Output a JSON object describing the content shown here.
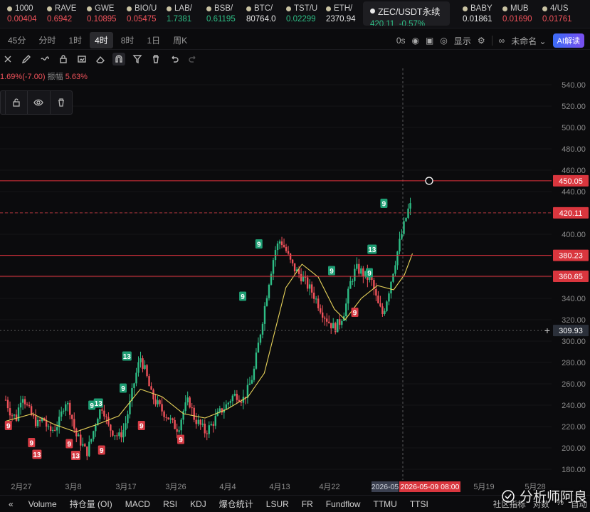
{
  "tickers": [
    {
      "sym": "1000",
      "price": "0.00404",
      "dir": "down"
    },
    {
      "sym": "RAVE",
      "price": "0.6942",
      "dir": "down"
    },
    {
      "sym": "GWE",
      "price": "0.10895",
      "dir": "down"
    },
    {
      "sym": "BIO/U",
      "price": "0.05475",
      "dir": "down"
    },
    {
      "sym": "LAB/",
      "price": "1.7381",
      "dir": "up"
    },
    {
      "sym": "BSB/",
      "price": "0.61195",
      "dir": "up"
    },
    {
      "sym": "BTC/",
      "price": "80764.0",
      "dir": "neu"
    },
    {
      "sym": "TST/U",
      "price": "0.02299",
      "dir": "up"
    },
    {
      "sym": "ETH/",
      "price": "2370.94",
      "dir": "neu"
    }
  ],
  "active_ticker": {
    "sym": "ZEC/USDT永续",
    "price": "420.11",
    "change": "-0.57%"
  },
  "tickers_right": [
    {
      "sym": "BABY",
      "price": "0.01861",
      "dir": "neu"
    },
    {
      "sym": "MUB",
      "price": "0.01690",
      "dir": "down"
    },
    {
      "sym": "4/US",
      "price": "0.01761",
      "dir": "down"
    }
  ],
  "intervals": [
    "45分",
    "分时",
    "1时",
    "4时",
    "8时",
    "1日",
    "周K"
  ],
  "active_interval": "4时",
  "toolbar_right": {
    "countdown": "0s",
    "display": "显示",
    "layout_name": "未命名",
    "ai_label": "AI解读"
  },
  "info": {
    "change": "1.69%(-7.00)",
    "amp_label": "振幅",
    "amp": "5.63%"
  },
  "colors": {
    "up": "#2ebd85",
    "down": "#f0525a",
    "bg": "#0b0b0d",
    "ma": "#e8d35a",
    "hline": "#e0323c",
    "accent_ai": "#5b5cf2"
  },
  "chart_data": {
    "type": "candlestick",
    "symbol": "ZEC/USDT永续",
    "interval": "4时",
    "y_range": [
      170,
      550
    ],
    "y_ticks": [
      180,
      200,
      220,
      240,
      260,
      280,
      300,
      320,
      340,
      360,
      380,
      400,
      420,
      440,
      460,
      480,
      500,
      520,
      540
    ],
    "x_dates": [
      "2月27",
      "3月8",
      "3月17",
      "3月26",
      "4月4",
      "4月13",
      "4月22",
      "2026-05",
      "5月19",
      "5月28"
    ],
    "price_markers": [
      {
        "value": "450.05",
        "style": "solid"
      },
      {
        "value": "420.11",
        "style": "dashed"
      },
      {
        "value": "380.23",
        "style": "solid"
      },
      {
        "value": "360.65",
        "style": "solid"
      },
      {
        "value": "309.93",
        "style": "dotted"
      }
    ],
    "crosshair_date": "2026-05-09 08:00",
    "close_path": [
      [
        0,
        245
      ],
      [
        0.01,
        232
      ],
      [
        0.02,
        228
      ],
      [
        0.03,
        252
      ],
      [
        0.04,
        238
      ],
      [
        0.05,
        228
      ],
      [
        0.06,
        222
      ],
      [
        0.07,
        228
      ],
      [
        0.08,
        215
      ],
      [
        0.09,
        218
      ],
      [
        0.1,
        225
      ],
      [
        0.11,
        245
      ],
      [
        0.12,
        235
      ],
      [
        0.13,
        212
      ],
      [
        0.14,
        205
      ],
      [
        0.15,
        195
      ],
      [
        0.16,
        210
      ],
      [
        0.17,
        230
      ],
      [
        0.18,
        240
      ],
      [
        0.19,
        220
      ],
      [
        0.2,
        215
      ],
      [
        0.21,
        210
      ],
      [
        0.22,
        218
      ],
      [
        0.23,
        240
      ],
      [
        0.24,
        265
      ],
      [
        0.25,
        285
      ],
      [
        0.26,
        270
      ],
      [
        0.27,
        250
      ],
      [
        0.28,
        242
      ],
      [
        0.29,
        235
      ],
      [
        0.3,
        230
      ],
      [
        0.31,
        222
      ],
      [
        0.32,
        218
      ],
      [
        0.33,
        235
      ],
      [
        0.34,
        245
      ],
      [
        0.35,
        228
      ],
      [
        0.36,
        222
      ],
      [
        0.37,
        215
      ],
      [
        0.38,
        220
      ],
      [
        0.39,
        228
      ],
      [
        0.4,
        235
      ],
      [
        0.41,
        240
      ],
      [
        0.42,
        248
      ],
      [
        0.43,
        250
      ],
      [
        0.44,
        245
      ],
      [
        0.45,
        255
      ],
      [
        0.46,
        270
      ],
      [
        0.47,
        300
      ],
      [
        0.48,
        330
      ],
      [
        0.49,
        360
      ],
      [
        0.5,
        385
      ],
      [
        0.51,
        395
      ],
      [
        0.52,
        385
      ],
      [
        0.53,
        372
      ],
      [
        0.54,
        365
      ],
      [
        0.55,
        360
      ],
      [
        0.56,
        352
      ],
      [
        0.57,
        345
      ],
      [
        0.58,
        335
      ],
      [
        0.59,
        325
      ],
      [
        0.6,
        318
      ],
      [
        0.61,
        312
      ],
      [
        0.62,
        318
      ],
      [
        0.63,
        330
      ],
      [
        0.64,
        355
      ],
      [
        0.65,
        368
      ],
      [
        0.66,
        365
      ],
      [
        0.67,
        360
      ],
      [
        0.68,
        355
      ],
      [
        0.69,
        335
      ],
      [
        0.7,
        325
      ],
      [
        0.71,
        345
      ],
      [
        0.72,
        368
      ],
      [
        0.73,
        390
      ],
      [
        0.74,
        410
      ],
      [
        0.75,
        428
      ],
      [
        0.755,
        420
      ]
    ],
    "ma_path": [
      [
        0,
        225
      ],
      [
        0.05,
        232
      ],
      [
        0.09,
        222
      ],
      [
        0.13,
        215
      ],
      [
        0.17,
        222
      ],
      [
        0.21,
        230
      ],
      [
        0.25,
        255
      ],
      [
        0.29,
        248
      ],
      [
        0.33,
        232
      ],
      [
        0.37,
        228
      ],
      [
        0.41,
        236
      ],
      [
        0.45,
        248
      ],
      [
        0.48,
        270
      ],
      [
        0.5,
        310
      ],
      [
        0.52,
        350
      ],
      [
        0.55,
        372
      ],
      [
        0.58,
        360
      ],
      [
        0.61,
        330
      ],
      [
        0.63,
        320
      ],
      [
        0.66,
        340
      ],
      [
        0.69,
        352
      ],
      [
        0.72,
        348
      ],
      [
        0.74,
        362
      ],
      [
        0.755,
        382
      ]
    ],
    "td_labels": [
      {
        "t": "9",
        "x": 0.005,
        "y": 221,
        "c": "down"
      },
      {
        "t": "9",
        "x": 0.048,
        "y": 205,
        "c": "down"
      },
      {
        "t": "13",
        "x": 0.058,
        "y": 194,
        "c": "down"
      },
      {
        "t": "9",
        "x": 0.118,
        "y": 204,
        "c": "down"
      },
      {
        "t": "13",
        "x": 0.13,
        "y": 193,
        "c": "down"
      },
      {
        "t": "9",
        "x": 0.16,
        "y": 240,
        "c": "up"
      },
      {
        "t": "13",
        "x": 0.172,
        "y": 242,
        "c": "up"
      },
      {
        "t": "9",
        "x": 0.178,
        "y": 198,
        "c": "down"
      },
      {
        "t": "9",
        "x": 0.218,
        "y": 256,
        "c": "up"
      },
      {
        "t": "13",
        "x": 0.225,
        "y": 286,
        "c": "up"
      },
      {
        "t": "9",
        "x": 0.252,
        "y": 221,
        "c": "down"
      },
      {
        "t": "9",
        "x": 0.325,
        "y": 208,
        "c": "down"
      },
      {
        "t": "9",
        "x": 0.44,
        "y": 342,
        "c": "up"
      },
      {
        "t": "9",
        "x": 0.47,
        "y": 391,
        "c": "up"
      },
      {
        "t": "9",
        "x": 0.605,
        "y": 366,
        "c": "up"
      },
      {
        "t": "9",
        "x": 0.648,
        "y": 327,
        "c": "down"
      },
      {
        "t": "9",
        "x": 0.675,
        "y": 364,
        "c": "up"
      },
      {
        "t": "13",
        "x": 0.68,
        "y": 386,
        "c": "up"
      },
      {
        "t": "9",
        "x": 0.702,
        "y": 429,
        "c": "up"
      }
    ]
  },
  "indicator_tabs": [
    "Volume",
    "持仓量 (OI)",
    "MACD",
    "RSI",
    "KDJ",
    "爆仓统计",
    "LSUR",
    "FR",
    "Fundflow",
    "TTMU",
    "TTSI"
  ],
  "indicator_right": [
    "社区指标",
    "对数",
    "%",
    "自动"
  ],
  "watermark": "分析师阿良"
}
